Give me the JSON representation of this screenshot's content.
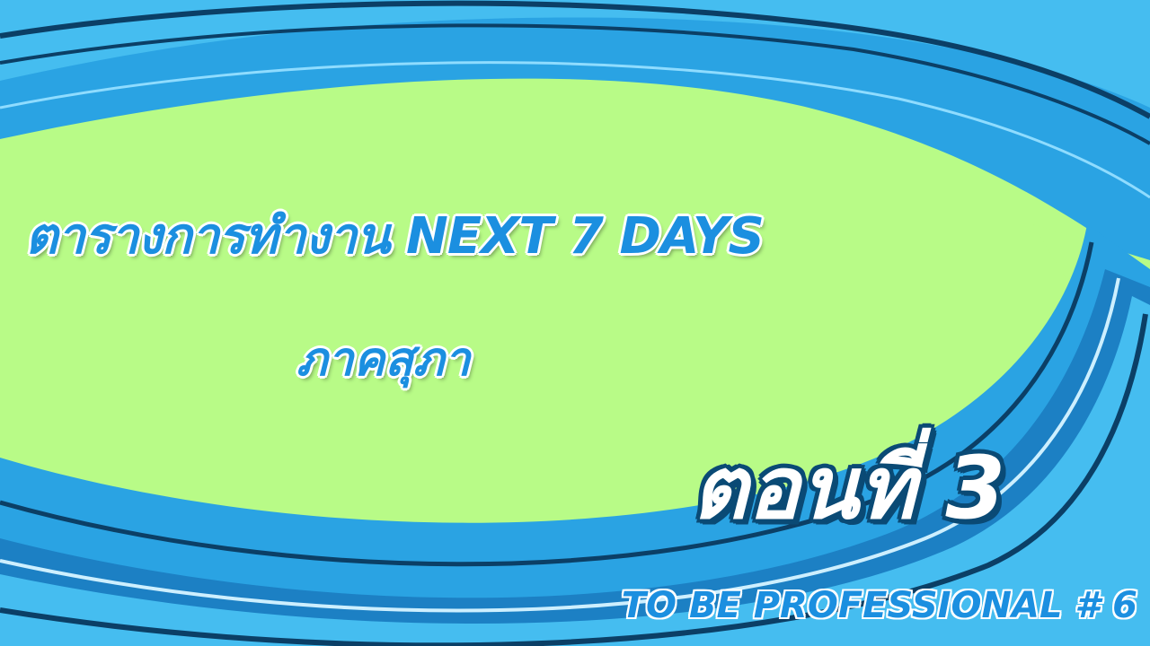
{
  "title": {
    "line1": "ตารางการทำงาน NEXT 7 DAYS",
    "line2": "ภาคสุภา"
  },
  "episode_label": "ตอนที่ 3",
  "series_label": "TO BE PROFESSIONAL # 6",
  "colors": {
    "background": "#b8fb87",
    "swoosh_light": "#3db8ee",
    "swoosh_mid": "#1f93d8",
    "swoosh_dark": "#0b3f66",
    "title_text": "#1b8fe0",
    "episode_text": "#ffffff",
    "episode_outline": "#0a4a75"
  }
}
